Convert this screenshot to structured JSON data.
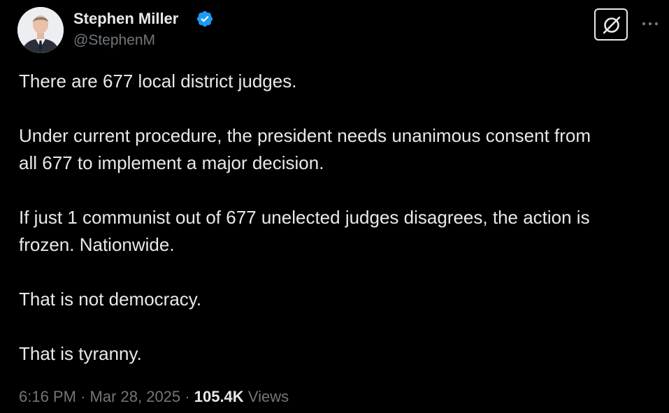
{
  "author": {
    "display_name": "Stephen Miller",
    "handle": "@StephenM",
    "verified": true,
    "verified_color": "#1d9bf0",
    "avatar_icon": "profile-photo"
  },
  "header_actions": {
    "grok_icon": "grok-icon",
    "more_icon": "more-options-icon"
  },
  "tweet": {
    "paragraphs": [
      "There are 677 local district judges.",
      "Under current procedure, the president needs unanimous consent from",
      "all 677 to implement a major decision.",
      "If just 1 communist out of 677 unelected judges disagrees, the action is",
      "frozen. Nationwide.",
      "That is not democracy.",
      "That is tyranny."
    ]
  },
  "meta": {
    "time": "6:16 PM",
    "separator": "·",
    "date": "Mar 28, 2025",
    "views_count": "105.4K",
    "views_label": "Views"
  },
  "colors": {
    "background": "#000000",
    "primary_text": "#e7e9ea",
    "secondary_text": "#71767b"
  }
}
